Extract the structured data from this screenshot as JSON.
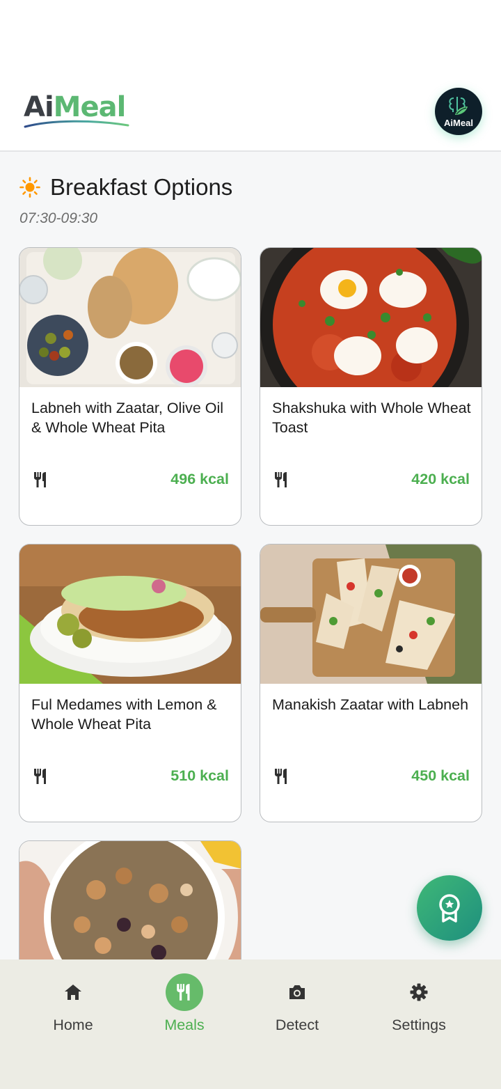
{
  "app": {
    "logo_part1": "Ai",
    "logo_part2": "Meal",
    "avatar_label": "AiMeal"
  },
  "section": {
    "title": "Breakfast Options",
    "time": "07:30-09:30",
    "icon": "sun-icon"
  },
  "meals": [
    {
      "name": "Labneh with Zaatar, Olive Oil & Whole Wheat Pita",
      "kcal": "496 kcal",
      "icon": "utensils-icon"
    },
    {
      "name": "Shakshuka with Whole Wheat Toast",
      "kcal": "420 kcal",
      "icon": "utensils-icon"
    },
    {
      "name": "Ful Medames with Lemon & Whole Wheat Pita",
      "kcal": "510 kcal",
      "icon": "utensils-icon"
    },
    {
      "name": "Manakish Zaatar with Labneh",
      "kcal": "450 kcal",
      "icon": "utensils-icon"
    },
    {
      "name": "",
      "kcal": "",
      "icon": "utensils-icon"
    }
  ],
  "fab": {
    "icon": "award-badge-icon"
  },
  "nav": {
    "items": [
      {
        "label": "Home",
        "icon": "home-icon"
      },
      {
        "label": "Meals",
        "icon": "utensils-icon",
        "active": true
      },
      {
        "label": "Detect",
        "icon": "camera-icon"
      },
      {
        "label": "Settings",
        "icon": "gear-icon"
      }
    ]
  },
  "colors": {
    "accent": "#4caf50",
    "nav_background": "#ecece4",
    "avatar_background": "#0e1f2a"
  }
}
